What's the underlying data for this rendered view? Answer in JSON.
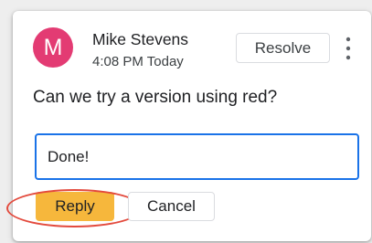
{
  "comment": {
    "avatar_initial": "M",
    "author": "Mike Stevens",
    "timestamp": "4:08 PM Today",
    "text": "Can we try a version using red?"
  },
  "actions": {
    "resolve_label": "Resolve",
    "more_icon": "more-vertical-icon"
  },
  "reply": {
    "value": "Done!",
    "submit_label": "Reply",
    "cancel_label": "Cancel"
  },
  "colors": {
    "avatar": "#e33b73",
    "reply_button": "#f6b73c",
    "input_focus": "#1a73e8",
    "annotation": "#e34a3d"
  }
}
